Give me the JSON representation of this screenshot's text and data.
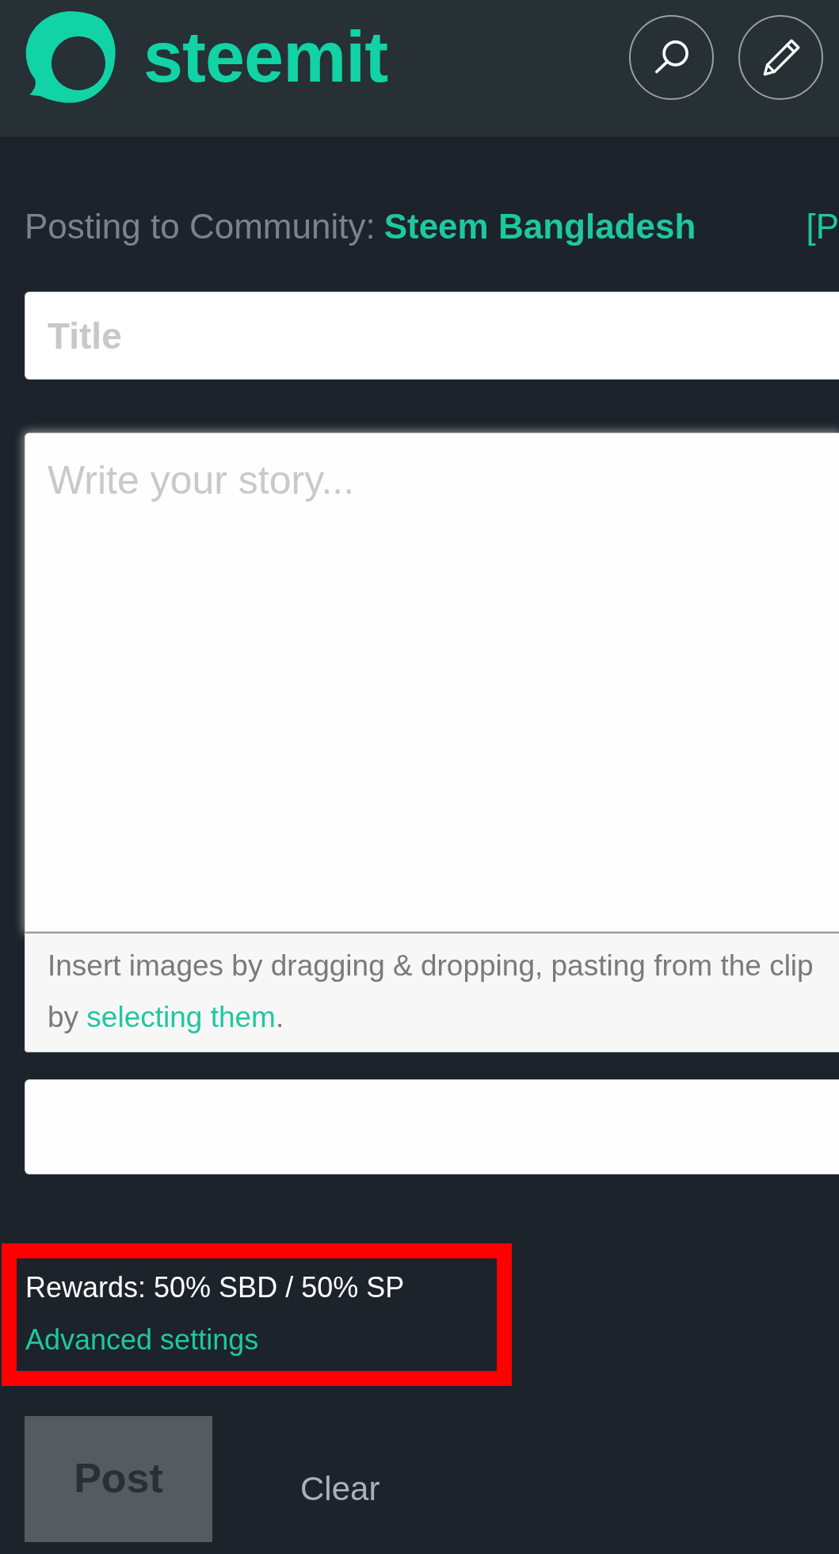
{
  "header": {
    "logo_text": "steemit"
  },
  "community": {
    "label": "Posting to Community:",
    "name": "Steem Bangladesh",
    "link": "[P"
  },
  "title_field": {
    "placeholder": "Title"
  },
  "editor": {
    "placeholder": "Write your story...",
    "hint": {
      "line_1": "Insert images by dragging & dropping, pasting from the clip",
      "line_2_before": "by ",
      "link": "selecting them",
      "line_2_after": "."
    }
  },
  "rewards": {
    "label": "Rewards: 50% SBD / 50% SP",
    "link": "Advanced settings"
  },
  "actions": [
    {
      "label": "Post",
      "kind": "primary",
      "disabled": true
    },
    {
      "label": "Clear",
      "kind": "plain",
      "disabled": false
    }
  ]
}
